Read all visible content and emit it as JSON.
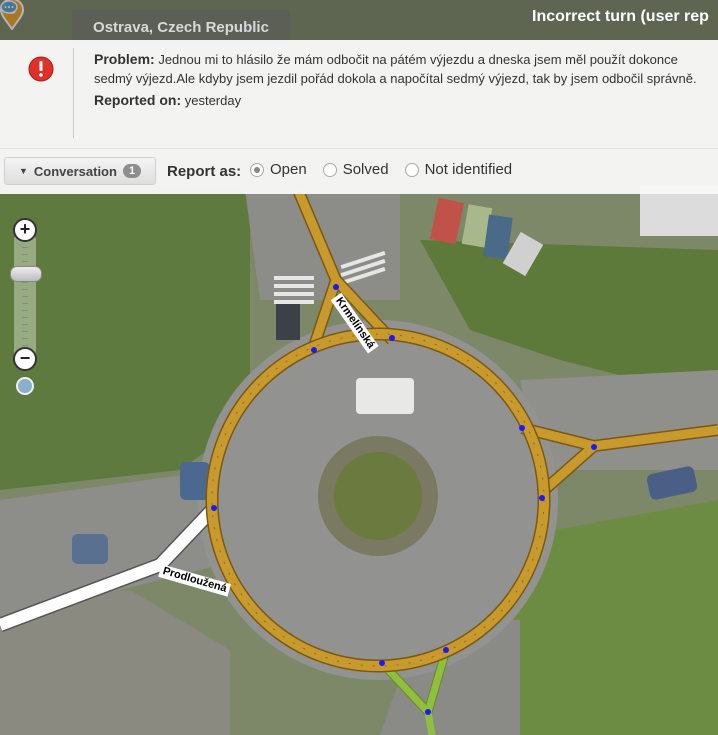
{
  "window": {
    "location": "Ostrava, Czech Republic",
    "panel_title": "Incorrect turn (user rep"
  },
  "problem": {
    "label": "Problem:",
    "text": "Jednou mi to hlásilo že mám odbočit na pátém výjezdu a dneska jsem měl použít dokonce sedmý výjezd.Ale kdyby jsem jezdil pořád dokola a napočítal sedmý výjezd, tak by jsem odbočil správně.",
    "reported_label": "Reported on:",
    "reported_value": "yesterday"
  },
  "conversation": {
    "label": "Conversation",
    "count": "1"
  },
  "report_as": {
    "label": "Report as:",
    "options": [
      "Open",
      "Solved",
      "Not identified"
    ],
    "selected": "Open"
  },
  "map": {
    "road_labels": [
      "Krmelínská",
      "Prodloužená"
    ],
    "colors": {
      "roundabout_road": "#c89a2e",
      "minor_road": "#ffffff",
      "green_road": "#8fbf3c",
      "node": "#1a1aff",
      "pin": "#f0a020"
    }
  }
}
